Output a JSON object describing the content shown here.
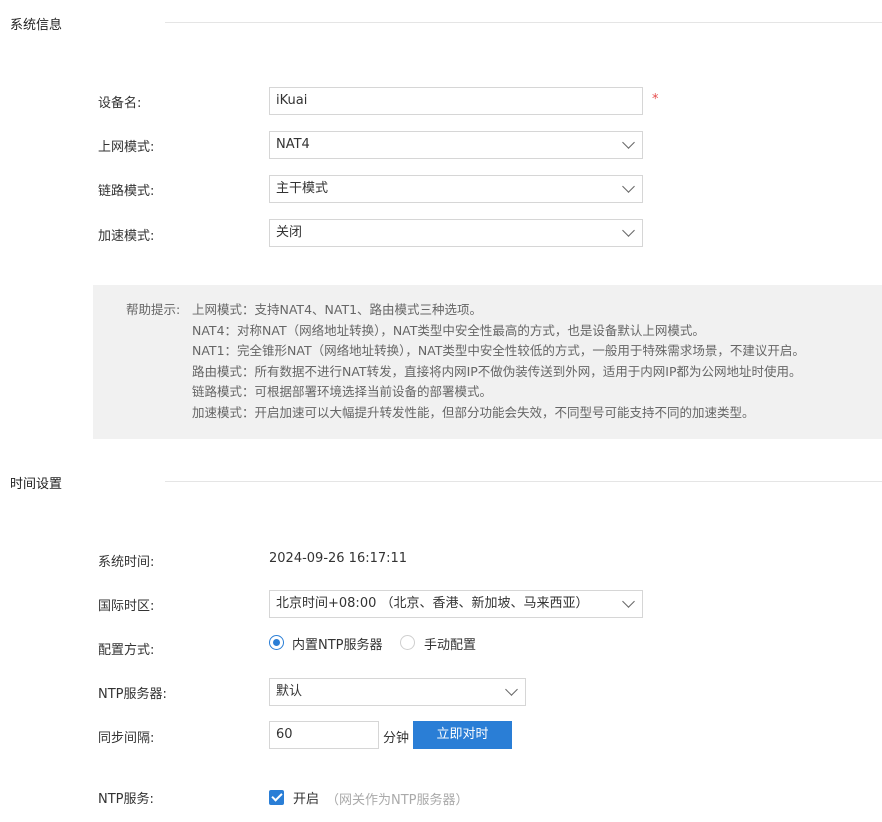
{
  "system_info": {
    "section_title": "系统信息",
    "device_name": {
      "label": "设备名:",
      "value": "iKuai",
      "required_mark": "*"
    },
    "wan_mode": {
      "label": "上网模式:",
      "selected": "NAT4"
    },
    "link_mode": {
      "label": "链路模式:",
      "selected": "主干模式"
    },
    "accel_mode": {
      "label": "加速模式:",
      "selected": "关闭"
    },
    "help": {
      "prefix": "帮助提示:",
      "lines": [
        "上网模式：支持NAT4、NAT1、路由模式三种选项。",
        "NAT4：对称NAT（网络地址转换），NAT类型中安全性最高的方式，也是设备默认上网模式。",
        "NAT1：完全锥形NAT（网络地址转换），NAT类型中安全性较低的方式，一般用于特殊需求场景，不建议开启。",
        "路由模式：所有数据不进行NAT转发，直接将内网IP不做伪装传送到外网，适用于内网IP都为公网地址时使用。",
        "链路模式：可根据部署环境选择当前设备的部署模式。",
        "加速模式：开启加速可以大幅提升转发性能，但部分功能会失效，不同型号可能支持不同的加速类型。"
      ]
    }
  },
  "time_settings": {
    "section_title": "时间设置",
    "system_time": {
      "label": "系统时间:",
      "value": "2024-09-26 16:17:11"
    },
    "timezone": {
      "label": "国际时区:",
      "selected": "北京时间+08:00 （北京、香港、新加坡、马来西亚）"
    },
    "config_method": {
      "label": "配置方式:",
      "options": [
        "内置NTP服务器",
        "手动配置"
      ],
      "selected_index": 0
    },
    "ntp_server": {
      "label": "NTP服务器:",
      "selected": "默认"
    },
    "sync_interval": {
      "label": "同步间隔:",
      "value": "60",
      "unit": "分钟",
      "sync_button": "立即对时"
    },
    "ntp_service": {
      "label": "NTP服务:",
      "checkbox_label": "开启",
      "checked": true,
      "hint": "（网关作为NTP服务器）"
    }
  },
  "colors": {
    "accent": "#2a7ed6",
    "required": "#e64c4c",
    "help_bg": "#f1f1f1"
  },
  "icons": {
    "select": "chevron-down-icon",
    "check": "check-icon"
  }
}
